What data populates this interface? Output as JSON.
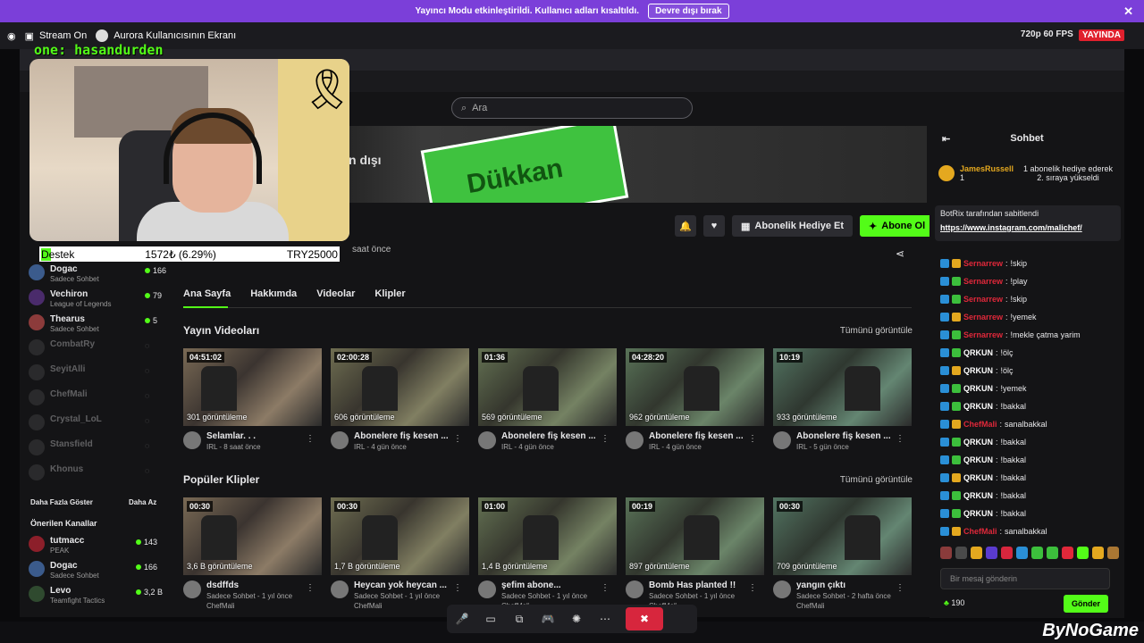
{
  "banner": {
    "text": "Yayıncı Modu etkinleştirildi. Kullanıcı adları kısaltıldı.",
    "button": "Devre dışı bırak"
  },
  "obs": {
    "item1": "Stream On",
    "item2": "Aurora Kullanıcısının Ekranı"
  },
  "quality": {
    "label": "720p 60 FPS",
    "live": "YAYINDA"
  },
  "overlay": {
    "name": "one: hasandurden"
  },
  "support": {
    "label": "Destek",
    "amount": "1572₺ (6.29%)",
    "goal": "TRY25000"
  },
  "search": {
    "placeholder": "Ara"
  },
  "channel_banner": {
    "text": "n dışı",
    "brand": "Dükkan"
  },
  "actions": {
    "gift": "Abonelik Hediye Et",
    "subscribe": "Abone Ol"
  },
  "channel_meta": {
    "ago": "saat önce"
  },
  "tabs": [
    "Ana Sayfa",
    "Hakkımda",
    "Videolar",
    "Klipler"
  ],
  "sections": {
    "videos": "Yayın Videoları",
    "clips": "Popüler Klipler",
    "see_all": "Tümünü görüntüle"
  },
  "videos": [
    {
      "duration": "04:51:02",
      "views": "301 görüntüleme",
      "title": "Selamlar. . .",
      "sub": "IRL - 8 saat önce"
    },
    {
      "duration": "02:00:28",
      "views": "606 görüntüleme",
      "title": "Abonelere fiş kesen ...",
      "sub": "IRL - 4 gün önce"
    },
    {
      "duration": "01:36",
      "views": "569 görüntüleme",
      "title": "Abonelere fiş kesen ...",
      "sub": "IRL - 4 gün önce"
    },
    {
      "duration": "04:28:20",
      "views": "962 görüntüleme",
      "title": "Abonelere fiş kesen ...",
      "sub": "IRL - 4 gün önce"
    },
    {
      "duration": "10:19",
      "views": "933 görüntüleme",
      "title": "Abonelere fiş kesen ...",
      "sub": "IRL - 5 gün önce"
    }
  ],
  "clips": [
    {
      "duration": "00:30",
      "views": "3,6 B görüntüleme",
      "title": "dsdffds",
      "sub": "Sadece Sohbet - 1 yıl önce",
      "author": "ChefMali"
    },
    {
      "duration": "00:30",
      "views": "1,7 B görüntüleme",
      "title": "Heycan yok heycan ...",
      "sub": "Sadece Sohbet - 1 yıl önce",
      "author": "ChefMali"
    },
    {
      "duration": "01:00",
      "views": "1,4 B görüntüleme",
      "title": "şefim abone...",
      "sub": "Sadece Sohbet - 1 yıl önce",
      "author": "ChefMali"
    },
    {
      "duration": "00:19",
      "views": "897 görüntüleme",
      "title": "Bomb Has planted !!",
      "sub": "Sadece Sohbet - 1 yıl önce",
      "author": "ChefMali"
    },
    {
      "duration": "00:30",
      "views": "709 görüntüleme",
      "title": "yangın çıktı",
      "sub": "Sadece Sohbet - 2 hafta önce",
      "author": "ChefMali"
    }
  ],
  "sidebar": {
    "following": [
      {
        "name": "Dogac",
        "cat": "Sadece Sohbet",
        "count": "166"
      },
      {
        "name": "Vechiron",
        "cat": "League of Legends",
        "count": "79"
      },
      {
        "name": "Thearus",
        "cat": "Sadece Sohbet",
        "count": "5"
      },
      {
        "name": "CombatRy",
        "cat": "",
        "count": ""
      },
      {
        "name": "SeyitAlli",
        "cat": "",
        "count": ""
      },
      {
        "name": "ChefMali",
        "cat": "",
        "count": ""
      },
      {
        "name": "Crystal_LoL",
        "cat": "",
        "count": ""
      },
      {
        "name": "Stansfield",
        "cat": "",
        "count": ""
      },
      {
        "name": "Khonus",
        "cat": "",
        "count": ""
      }
    ],
    "more": "Daha Fazla Göster",
    "less": "Daha Az",
    "suggested_title": "Önerilen Kanallar",
    "suggested": [
      {
        "name": "tutmacc",
        "cat": "PEAK",
        "count": "143"
      },
      {
        "name": "Dogac",
        "cat": "Sadece Sohbet",
        "count": "166"
      },
      {
        "name": "Levo",
        "cat": "Teamfight Tactics",
        "count": "3,2 B"
      }
    ]
  },
  "chat": {
    "title": "Sohbet",
    "gift_user": "JamesRussell",
    "gift_count": "1",
    "gift_text": "1 abonelik hediye ederek 2. sıraya yükseldi",
    "pinned_by": "BotRix tarafından sabitlendi",
    "pinned_link": "https://www.instagram.com/malichef/",
    "messages": [
      {
        "user": "Sernarrew",
        "text": "!skip",
        "color": "#e0283a"
      },
      {
        "user": "Sernarrew",
        "text": "!play",
        "color": "#e0283a"
      },
      {
        "user": "Sernarrew",
        "text": "!skip",
        "color": "#e0283a"
      },
      {
        "user": "Sernarrew",
        "text": "!yemek",
        "color": "#e0283a"
      },
      {
        "user": "Sernarrew",
        "text": "!mekle çatma yarim",
        "color": "#e0283a"
      },
      {
        "user": "QRKUN",
        "text": "!ölç",
        "color": "#ffffff"
      },
      {
        "user": "QRKUN",
        "text": "!ölç",
        "color": "#ffffff"
      },
      {
        "user": "QRKUN",
        "text": "!yemek",
        "color": "#ffffff"
      },
      {
        "user": "QRKUN",
        "text": "!bakkal",
        "color": "#ffffff"
      },
      {
        "user": "ChefMali",
        "text": "sanalbakkal",
        "color": "#e0283a"
      },
      {
        "user": "QRKUN",
        "text": "!bakkal",
        "color": "#ffffff"
      },
      {
        "user": "QRKUN",
        "text": "!bakkal",
        "color": "#ffffff"
      },
      {
        "user": "QRKUN",
        "text": "!bakkal",
        "color": "#ffffff"
      },
      {
        "user": "QRKUN",
        "text": "!bakkal",
        "color": "#ffffff"
      },
      {
        "user": "QRKUN",
        "text": "!bakkal",
        "color": "#ffffff"
      },
      {
        "user": "ChefMali",
        "text": "sanalbakkal",
        "color": "#e0283a"
      }
    ],
    "input_placeholder": "Bir mesaj gönderin",
    "points": "190",
    "send": "Gönder"
  },
  "brand": "ByNoGame",
  "colors": {
    "accent": "#53fc18",
    "banner": "#7b3fd9",
    "live": "#e0202d"
  }
}
